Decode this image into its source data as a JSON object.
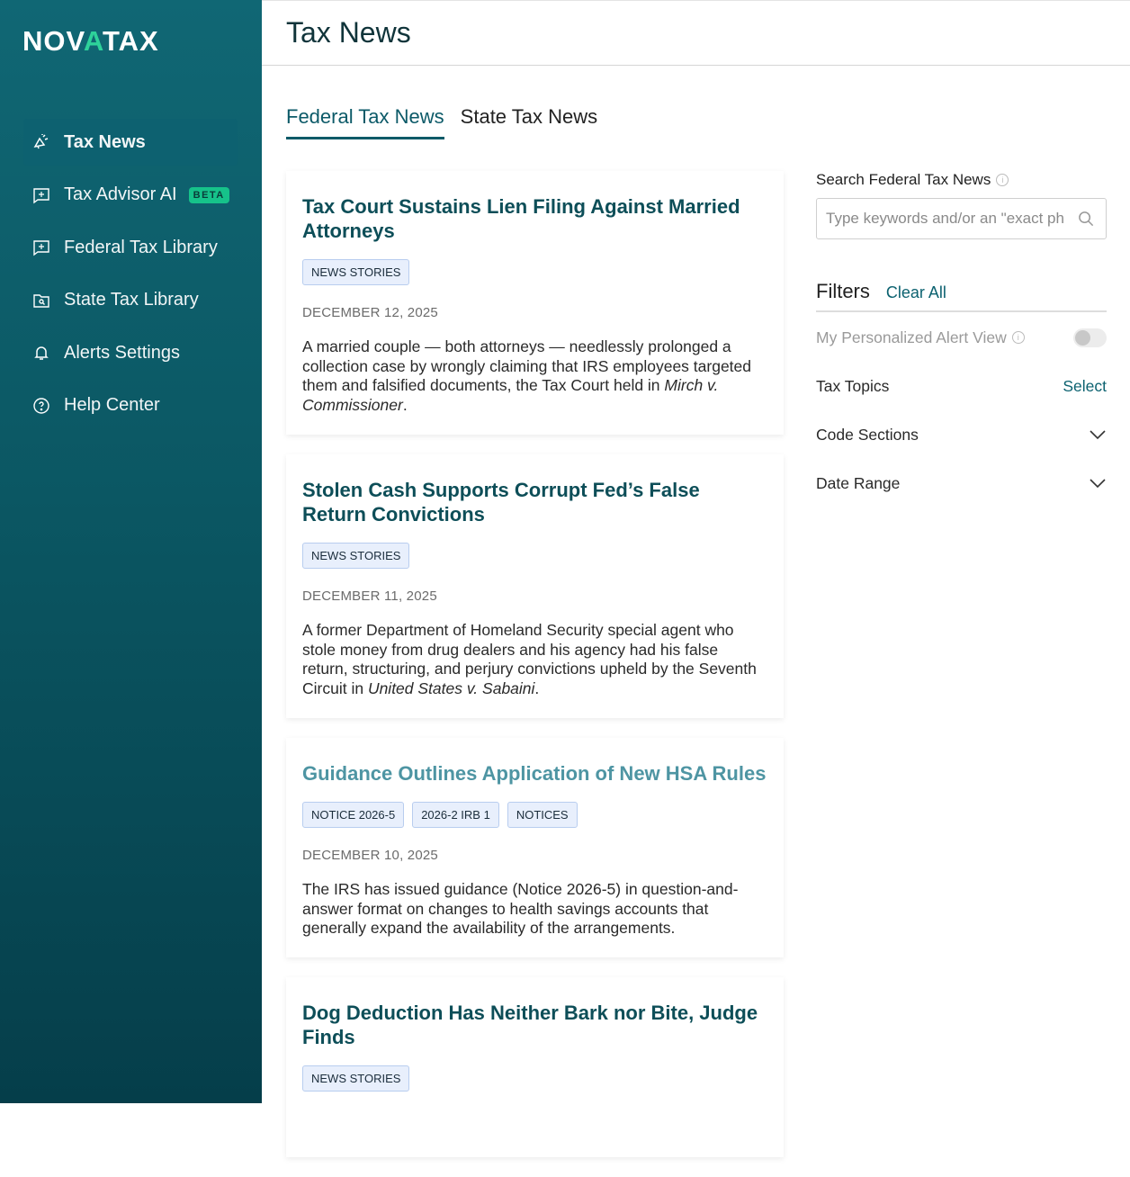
{
  "brand": {
    "logo_pre": "NOV",
    "logo_mid": "A",
    "logo_post": "TAX"
  },
  "sidebar": {
    "items": [
      {
        "label": "Tax News",
        "icon": "megaphone-icon",
        "active": true
      },
      {
        "label": "Tax Advisor AI",
        "icon": "chat-sparkle-icon",
        "badge": "BETA"
      },
      {
        "label": "Federal Tax Library",
        "icon": "chat-sparkle-icon"
      },
      {
        "label": "State Tax Library",
        "icon": "folder-search-icon"
      },
      {
        "label": "Alerts Settings",
        "icon": "bell-icon"
      },
      {
        "label": "Help Center",
        "icon": "help-circle-icon"
      }
    ]
  },
  "header": {
    "title": "Tax News"
  },
  "tabs": [
    {
      "label": "Federal Tax News",
      "active": true
    },
    {
      "label": "State Tax News"
    }
  ],
  "articles": [
    {
      "title": "Tax Court Sustains Lien Filing Against Married Attorneys",
      "tags": [
        "NEWS STORIES"
      ],
      "date": "DECEMBER 12, 2025",
      "body": "A married couple — both attorneys — needlessly prolonged a collection case by wrongly claiming that IRS employees targeted them and falsified documents, the Tax Court held in ",
      "body_italic": "Mirch v. Commissioner",
      "body_end": "."
    },
    {
      "title": "Stolen Cash Supports Corrupt Fed’s False Return Convictions",
      "tags": [
        "NEWS STORIES"
      ],
      "date": "DECEMBER 11, 2025",
      "body": "A former Department of Homeland Security special agent who stole money from drug dealers and his agency had his false return, structuring, and perjury convictions upheld by the Seventh Circuit in ",
      "body_italic": "United States v. Sabaini",
      "body_end": "."
    },
    {
      "title": "Guidance Outlines Application of New HSA Rules",
      "tags": [
        "NOTICE 2026-5",
        "2026-2 IRB 1",
        "NOTICES"
      ],
      "date": "DECEMBER 10, 2025",
      "body": "The IRS has issued guidance (Notice 2026-5) in question-and-answer format on changes to health savings accounts that generally expand the availability of the arrangements.",
      "body_italic": "",
      "body_end": ""
    },
    {
      "title": "Dog Deduction Has Neither Bark nor Bite, Judge Finds",
      "tags": [
        "NEWS STORIES"
      ]
    }
  ],
  "search": {
    "label": "Search Federal Tax News",
    "placeholder": "Type keywords and/or an \"exact phrase\""
  },
  "filters": {
    "title": "Filters",
    "clear_all": "Clear All",
    "alert_view": "My Personalized Alert View",
    "alert_view_on": false,
    "tax_topics": "Tax Topics",
    "select": "Select",
    "code_sections": "Code Sections",
    "date_range": "Date Range"
  }
}
